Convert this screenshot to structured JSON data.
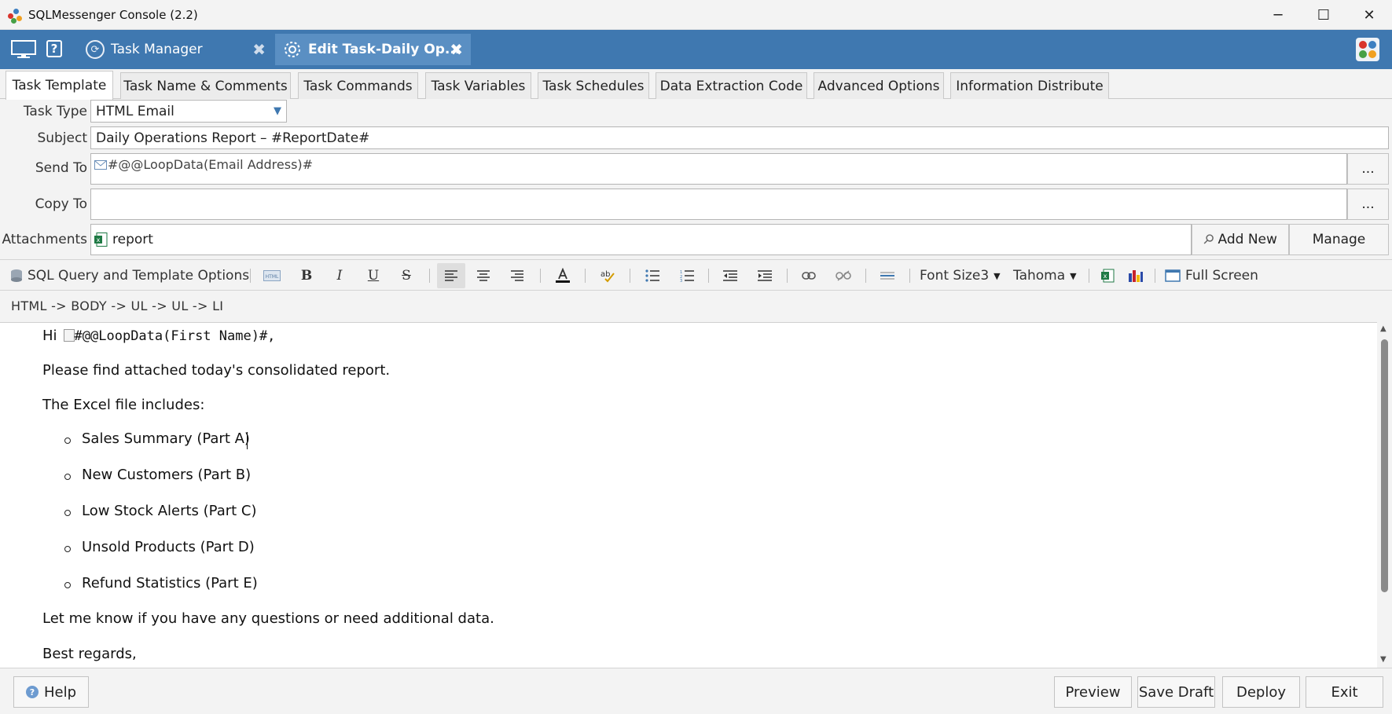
{
  "window": {
    "title": "SQLMessenger Console (2.2)",
    "minimize": "─",
    "maximize": "☐",
    "close": "✕"
  },
  "topbar": {
    "help": "?",
    "tabs": [
      {
        "label": "Task Manager",
        "close": "✖"
      },
      {
        "label": "Edit Task-Daily Op...",
        "close": "✖"
      }
    ]
  },
  "settings_tabs": [
    "Task Template",
    "Task Name & Comments",
    "Task Commands",
    "Task Variables",
    "Task Schedules",
    "Data Extraction Code",
    "Advanced Options",
    "Information Distribute"
  ],
  "form": {
    "task_type_label": "Task Type",
    "task_type_value": "HTML Email",
    "subject_label": "Subject",
    "subject_value": "Daily Operations Report – #ReportDate#",
    "send_to_label": "Send To",
    "send_to_value": "#@@LoopData(Email Address)#",
    "copy_to_label": "Copy To",
    "copy_to_value": "",
    "browse_label": "...",
    "attachments_label": "Attachments",
    "attachment_value": "report",
    "add_new_label": "Add New",
    "manage_label": "Manage"
  },
  "toolbar": {
    "sql_options_label": "SQL Query and Template Options",
    "bold": "B",
    "italic": "I",
    "underline": "U",
    "strike": "S",
    "font_size_label": "Font Size3",
    "font_name_label": "Tahoma",
    "full_screen_label": "Full Screen"
  },
  "breadcrumb": "HTML  ->  BODY  ->  UL  ->  UL  ->  LI",
  "editor": {
    "greeting_prefix": "Hi",
    "greeting_var": "#@@LoopData(First Name)#,",
    "line1": "Please find attached today's consolidated report.",
    "line2": "The Excel file includes:",
    "items": [
      "Sales Summary (Part A)",
      "New Customers (Part B)",
      "Low Stock Alerts (Part C)",
      "Unsold Products (Part D)",
      "Refund Statistics (Part E)"
    ],
    "line3": "Let me know if you have any questions or need additional data.",
    "line4": "Best regards,"
  },
  "bottom": {
    "help_label": "Help",
    "preview_label": "Preview",
    "save_draft_label": "Save Draft",
    "deploy_label": "Deploy",
    "exit_label": "Exit"
  },
  "colors": {
    "accent_blue": "#3f78b0",
    "active_tab_blue": "#5a8fc3"
  }
}
